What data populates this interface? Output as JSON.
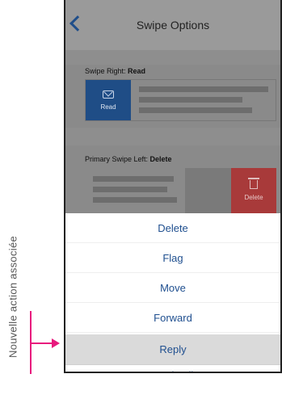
{
  "annotation": {
    "text": "Nouvelle action associée"
  },
  "header": {
    "title": "Swipe Options"
  },
  "swipe_right": {
    "label_prefix": "Swipe Right: ",
    "label_value": "Read",
    "action_label": "Read"
  },
  "swipe_left": {
    "label_prefix": "Primary Swipe Left: ",
    "label_value": "Delete",
    "action_label": "Delete"
  },
  "action_sheet": {
    "items": [
      "Delete",
      "Flag",
      "Move",
      "Forward",
      "Reply",
      "Reply All"
    ],
    "selected": "Reply"
  },
  "colors": {
    "accent": "#1f4f8f",
    "annotation": "#e8197d",
    "read_tile": "#1f4d86",
    "delete_tile": "#a83a3a"
  }
}
